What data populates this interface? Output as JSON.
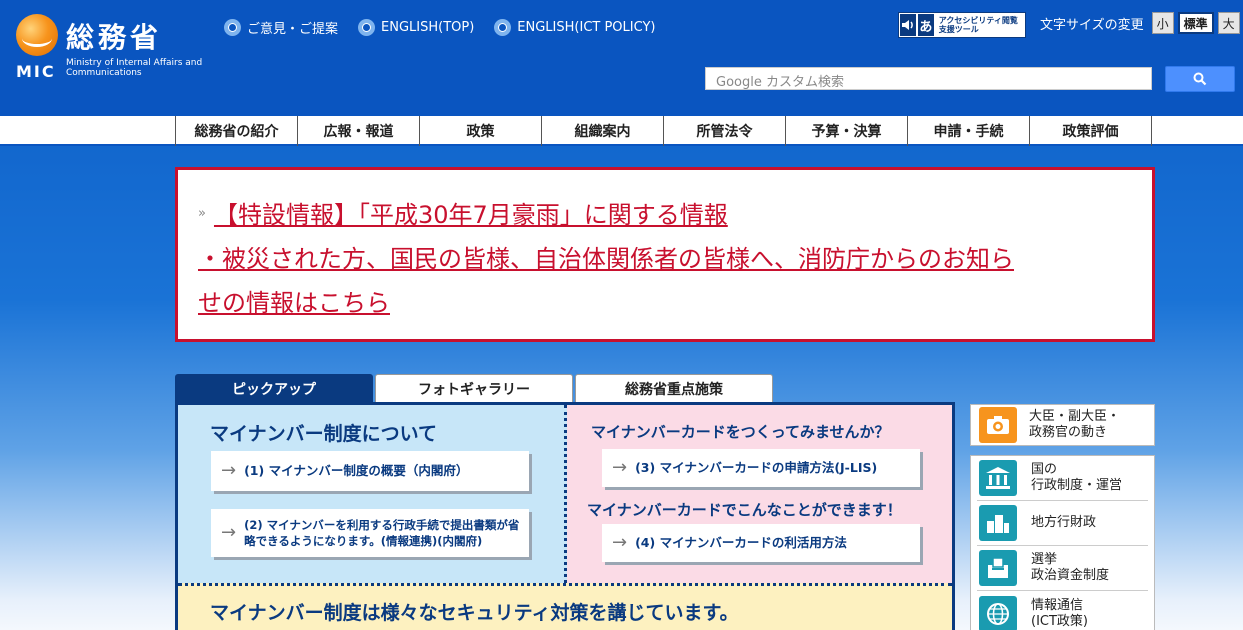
{
  "header": {
    "logo": {
      "name": "総務省",
      "abbr": "MIC",
      "english": "Ministry of Internal Affairs and Communications"
    },
    "top_links": [
      {
        "label": "ご意見・ご提案"
      },
      {
        "label": "ENGLISH(TOP)"
      },
      {
        "label": "ENGLISH(ICT POLICY)"
      }
    ],
    "accessibility_tool": {
      "label": "アクセシビリティ閲覧支援ツール"
    },
    "font_size": {
      "label": "文字サイズの変更",
      "options": [
        "小",
        "標準",
        "大"
      ],
      "selected": "標準"
    },
    "search": {
      "placeholder": "Google カスタム検索"
    }
  },
  "nav": {
    "items": [
      "総務省の紹介",
      "広報・報道",
      "政策",
      "組織案内",
      "所管法令",
      "予算・決算",
      "申請・手続",
      "政策評価"
    ]
  },
  "notice": {
    "line1": "【特設情報】「平成30年7月豪雨」に関する情報",
    "line2": "・被災された方、国民の皆様、自治体関係者の皆様へ、消防庁からのお知ら",
    "line3": "せの情報はこちら",
    "mark": "»"
  },
  "tabs": [
    "ピックアップ",
    "フォトギャラリー",
    "総務省重点施策"
  ],
  "pickup": {
    "left_title": "マイナンバー制度について",
    "left_links": [
      "(1) マイナンバー制度の概要（内閣府）",
      "(2) マイナンバーを利用する行政手続で提出書類が省略できるようになります。(情報連携)(内閣府)"
    ],
    "right_title1": "マイナンバーカードをつくってみませんか？",
    "right_link1": "(3) マイナンバーカードの申請方法(J-LIS)",
    "right_title2": "マイナンバーカードでこんなことができます！",
    "right_link2": "(4) マイナンバーカードの利活用方法",
    "bottom_title": "マイナンバー制度は様々なセキュリティ対策を講じています。"
  },
  "sidebar": {
    "top": {
      "label": "大臣・副大臣・政務官の動き",
      "line1": "大臣・副大臣・",
      "line2": "政務官の動き"
    },
    "items": [
      {
        "line1": "国の",
        "line2": "行政制度・運営"
      },
      {
        "line1": "地方行財政",
        "line2": ""
      },
      {
        "line1": "選挙",
        "line2": "政治資金制度"
      },
      {
        "line1": "情報通信",
        "line2": "(ICT政策)"
      }
    ]
  },
  "colors": {
    "header": "#0a55c0",
    "navy": "#0a3a80",
    "alert": "#c8102e",
    "accent": "#f7941d",
    "teal": "#1a9bb0"
  }
}
